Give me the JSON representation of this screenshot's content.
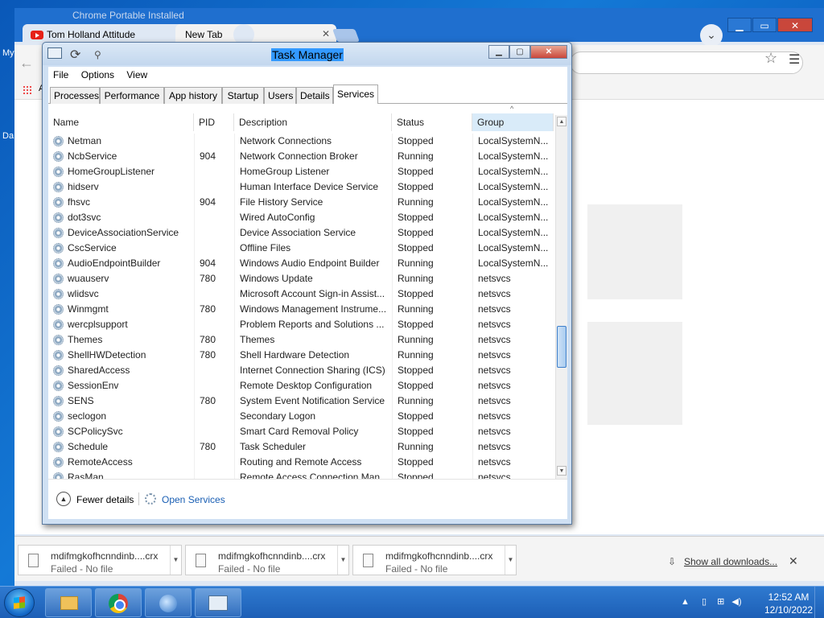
{
  "desktop": {
    "label_my": "My",
    "label_da": "Da"
  },
  "chrome": {
    "tabs": [
      {
        "title": "Tom Holland Attitude"
      },
      {
        "title": "New Tab"
      }
    ],
    "ghost_tab_text": "Chrome Portable Installed",
    "bookmarks_partial": "A",
    "downloads": [
      {
        "name": "mdifmgkofhcnndinb....crx",
        "status": "Failed - No file"
      },
      {
        "name": "mdifmgkofhcnndinb....crx",
        "status": "Failed - No file"
      },
      {
        "name": "mdifmgkofhcnndinb....crx",
        "status": "Failed - No file"
      }
    ],
    "show_all_downloads": "Show all downloads..."
  },
  "task_manager": {
    "title": "Task Manager",
    "menu": [
      "File",
      "Options",
      "View"
    ],
    "tabs": [
      "Processes",
      "Performance",
      "App history",
      "Startup",
      "Users",
      "Details",
      "Services"
    ],
    "active_tab": "Services",
    "columns": [
      "Name",
      "PID",
      "Description",
      "Status",
      "Group"
    ],
    "sorted_column": "Group",
    "services": [
      {
        "name": "Netman",
        "pid": "",
        "description": "Network Connections",
        "status": "Stopped",
        "group": "LocalSystemN..."
      },
      {
        "name": "NcbService",
        "pid": "904",
        "description": "Network Connection Broker",
        "status": "Running",
        "group": "LocalSystemN..."
      },
      {
        "name": "HomeGroupListener",
        "pid": "",
        "description": "HomeGroup Listener",
        "status": "Stopped",
        "group": "LocalSystemN..."
      },
      {
        "name": "hidserv",
        "pid": "",
        "description": "Human Interface Device Service",
        "status": "Stopped",
        "group": "LocalSystemN..."
      },
      {
        "name": "fhsvc",
        "pid": "904",
        "description": "File History Service",
        "status": "Running",
        "group": "LocalSystemN..."
      },
      {
        "name": "dot3svc",
        "pid": "",
        "description": "Wired AutoConfig",
        "status": "Stopped",
        "group": "LocalSystemN..."
      },
      {
        "name": "DeviceAssociationService",
        "pid": "",
        "description": "Device Association Service",
        "status": "Stopped",
        "group": "LocalSystemN..."
      },
      {
        "name": "CscService",
        "pid": "",
        "description": "Offline Files",
        "status": "Stopped",
        "group": "LocalSystemN..."
      },
      {
        "name": "AudioEndpointBuilder",
        "pid": "904",
        "description": "Windows Audio Endpoint Builder",
        "status": "Running",
        "group": "LocalSystemN..."
      },
      {
        "name": "wuauserv",
        "pid": "780",
        "description": "Windows Update",
        "status": "Running",
        "group": "netsvcs"
      },
      {
        "name": "wlidsvc",
        "pid": "",
        "description": "Microsoft Account Sign-in Assist...",
        "status": "Stopped",
        "group": "netsvcs"
      },
      {
        "name": "Winmgmt",
        "pid": "780",
        "description": "Windows Management Instrume...",
        "status": "Running",
        "group": "netsvcs"
      },
      {
        "name": "wercplsupport",
        "pid": "",
        "description": "Problem Reports and Solutions ...",
        "status": "Stopped",
        "group": "netsvcs"
      },
      {
        "name": "Themes",
        "pid": "780",
        "description": "Themes",
        "status": "Running",
        "group": "netsvcs"
      },
      {
        "name": "ShellHWDetection",
        "pid": "780",
        "description": "Shell Hardware Detection",
        "status": "Running",
        "group": "netsvcs"
      },
      {
        "name": "SharedAccess",
        "pid": "",
        "description": "Internet Connection Sharing (ICS)",
        "status": "Stopped",
        "group": "netsvcs"
      },
      {
        "name": "SessionEnv",
        "pid": "",
        "description": "Remote Desktop Configuration",
        "status": "Stopped",
        "group": "netsvcs"
      },
      {
        "name": "SENS",
        "pid": "780",
        "description": "System Event Notification Service",
        "status": "Running",
        "group": "netsvcs"
      },
      {
        "name": "seclogon",
        "pid": "",
        "description": "Secondary Logon",
        "status": "Stopped",
        "group": "netsvcs"
      },
      {
        "name": "SCPolicySvc",
        "pid": "",
        "description": "Smart Card Removal Policy",
        "status": "Stopped",
        "group": "netsvcs"
      },
      {
        "name": "Schedule",
        "pid": "780",
        "description": "Task Scheduler",
        "status": "Running",
        "group": "netsvcs"
      },
      {
        "name": "RemoteAccess",
        "pid": "",
        "description": "Routing and Remote Access",
        "status": "Stopped",
        "group": "netsvcs"
      },
      {
        "name": "RasMan",
        "pid": "",
        "description": "Remote Access Connection Man...",
        "status": "Stopped",
        "group": "netsvcs"
      }
    ],
    "footer": {
      "fewer_details": "Fewer details",
      "open_services": "Open Services"
    }
  },
  "taskbar": {
    "time": "12:52 AM",
    "date": "12/10/2022",
    "apps": [
      "folder-icon",
      "chrome-icon",
      "globe-icon",
      "task-manager-icon"
    ]
  }
}
